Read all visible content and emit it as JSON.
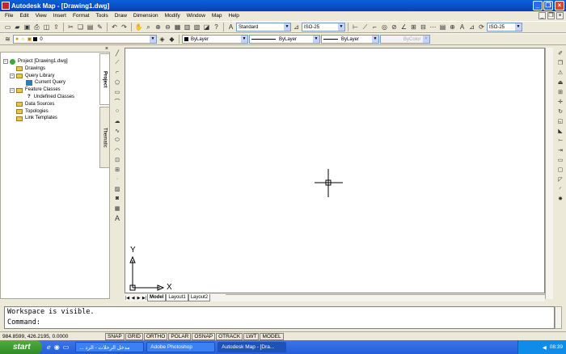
{
  "window": {
    "title": "Autodesk Map - [Drawing1.dwg]"
  },
  "menu": [
    "File",
    "Edit",
    "View",
    "Insert",
    "Format",
    "Tools",
    "Draw",
    "Dimension",
    "Modify",
    "Window",
    "Map",
    "Help"
  ],
  "toolbar": {
    "text_style": "Standard",
    "dim_style": "ISO-25",
    "dim_style_right": "ISO-25",
    "layer": "0",
    "color": "ByLayer",
    "linetype": "ByLayer",
    "lineweight": "ByLayer",
    "plotstyle": "ByColor"
  },
  "workspace": {
    "tabs": {
      "project": "Project",
      "thematic": "Thematic"
    },
    "tree": [
      {
        "label": "Project [Drawing1.dwg]",
        "level": 0
      },
      {
        "label": "Drawings",
        "level": 1
      },
      {
        "label": "Query Library",
        "level": 1
      },
      {
        "label": "Current Query",
        "level": 2
      },
      {
        "label": "Feature Classes",
        "level": 1
      },
      {
        "label": "Undefined Classes",
        "level": 2
      },
      {
        "label": "Data Sources",
        "level": 1
      },
      {
        "label": "Topologies",
        "level": 1
      },
      {
        "label": "Link Templates",
        "level": 1
      }
    ]
  },
  "drawing": {
    "ucs_x": "X",
    "ucs_y": "Y"
  },
  "layout_tabs": [
    "Model",
    "Layout1",
    "Layout2"
  ],
  "command": {
    "line1": "Workspace is visible.",
    "line2": "Command:"
  },
  "status": {
    "coords": "984.8599, 426.2195, 0.0000",
    "buttons": [
      "SNAP",
      "GRID",
      "ORTHO",
      "POLAR",
      "OSNAP",
      "OTRACK",
      "LWT",
      "MODEL"
    ]
  },
  "taskbar": {
    "start": "start",
    "tasks": [
      "... مدخل الرحلات - الرد",
      "Adobe Photoshop",
      "Autodesk Map - [Dra..."
    ],
    "clock": "08:39"
  }
}
